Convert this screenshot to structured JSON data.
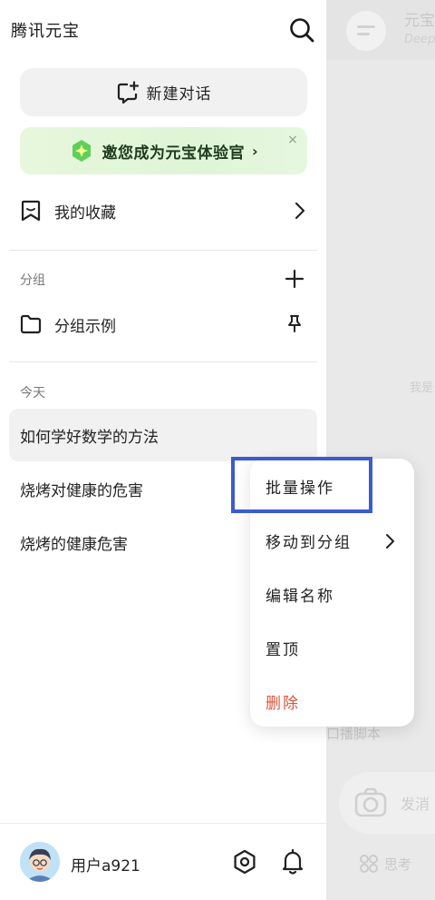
{
  "drawer": {
    "app_title": "腾讯元宝",
    "new_chat_label": "新建对话",
    "banner": {
      "label": "邀您成为元宝体验官",
      "chevron": "›",
      "close": "×"
    },
    "favorites_label": "我的收藏",
    "group_heading": "分组",
    "group_items": [
      {
        "label": "分组示例"
      }
    ],
    "today_heading": "今天",
    "chats": [
      {
        "title": "如何学好数学的方法",
        "selected": true
      },
      {
        "title": "烧烤对健康的危害",
        "selected": false
      },
      {
        "title": "烧烤的健康危害",
        "selected": false
      }
    ],
    "user": {
      "name": "用户a921"
    }
  },
  "main": {
    "title": "元宝",
    "subtitle": "DeepS",
    "hint": "我是",
    "clip_text": "口播脚本",
    "input_placeholder": "发消",
    "think_label": "思考"
  },
  "context_menu": {
    "items": [
      {
        "label": "批量操作",
        "highlighted": true
      },
      {
        "label": "移动到分组",
        "has_submenu": true
      },
      {
        "label": "编辑名称"
      },
      {
        "label": "置顶"
      },
      {
        "label": "删除",
        "danger": true
      }
    ]
  },
  "colors": {
    "danger": "#e0533b",
    "highlight": "#3b5bd0",
    "banner_bg": "#e7f7dc",
    "overlay": "#e9e9e9"
  },
  "icons": [
    "search-icon",
    "new-chat-icon",
    "sparkle-icon",
    "close-icon",
    "bookmark-icon",
    "chevron-right-icon",
    "plus-icon",
    "folder-icon",
    "pin-icon",
    "settings-icon",
    "bell-icon",
    "camera-icon",
    "think-icon",
    "menu-icon"
  ]
}
